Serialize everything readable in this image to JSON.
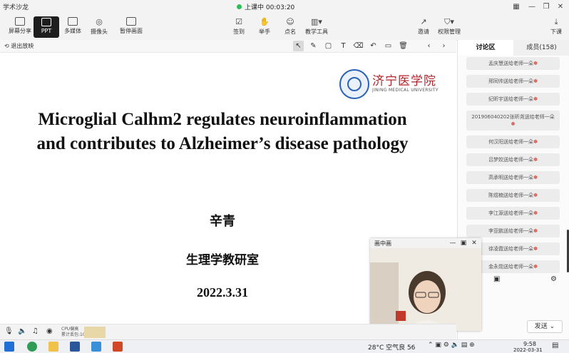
{
  "app": {
    "title": "学术沙龙",
    "class_status": "上课中 00:03:20"
  },
  "toolbar": {
    "screen_share": "屏幕分享",
    "ppt": "PPT",
    "media": "多媒体",
    "camera": "摄像头",
    "pause": "暂停画面",
    "sign_in": "签到",
    "raise_hand": "举手",
    "roll_call": "点名",
    "teaching_tools": "教学工具",
    "invite": "邀请",
    "permissions": "权限管理",
    "download": "下课"
  },
  "subbar": {
    "exit": "退出放映"
  },
  "slide": {
    "logo_cn": "济宁医学院",
    "logo_en": "JINING MEDICAL UNIVERSITY",
    "title_line1": "Microglial Calhm2 regulates neuroinflammation",
    "title_line2": "and contributes to Alzheimer’s disease pathology",
    "presenter": "辛青",
    "department": "生理学教研室",
    "date": "2022.3.31"
  },
  "panel": {
    "tab_discuss": "讨论区",
    "tab_members": "成员(158)",
    "messages": [
      "孟庆慧送给老师一朵",
      "邢同帅送给老师一朵",
      "纪昕宇送给老师一朵",
      "201906040202张昕尧送给老师一朵",
      "何汉阳送给老师一朵",
      "吕梦姣送给老师一朵",
      "高承明送给老师一朵",
      "陈煜楠送给老师一朵",
      "李江源送给老师一朵",
      "李亚鹏送给老师一朵",
      "徐凌霞送给老师一朵",
      "金永勋送给老师一朵"
    ],
    "send": "发送"
  },
  "pip": {
    "title": "画中画"
  },
  "status": {
    "cpu_line1": "CPU偏高",
    "cpu_line2": "累计丢包:10"
  },
  "taskbar": {
    "weather": "28°C 空气良 56",
    "time": "9:58",
    "date": "2022-03-31"
  }
}
